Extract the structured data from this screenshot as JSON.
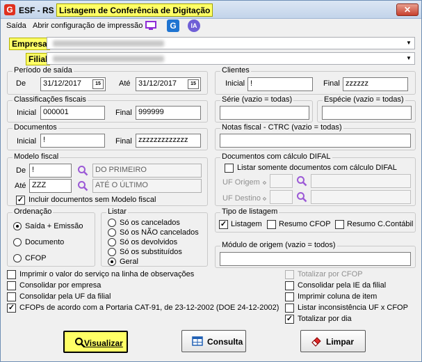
{
  "window": {
    "app_logo": "G",
    "title_prefix": "ESF - RS -",
    "title": "Listagem de Conferência de Digitação",
    "close_label": "✕"
  },
  "menu": {
    "saida": "Saída",
    "abrir_config": "Abrir configuração de impressão"
  },
  "toolbar_icons": [
    "monitor-icon",
    "g-logo-icon",
    "ia-icon"
  ],
  "toolbar": {
    "ia_label": "IA",
    "g_label": "G"
  },
  "empresa": {
    "label": "Empresa"
  },
  "filial": {
    "label": "Filial"
  },
  "periodo": {
    "title": "Período de saída",
    "de_label": "De",
    "de_value": "31/12/2017",
    "ate_label": "Até",
    "ate_value": "31/12/2017",
    "cal_label": "15"
  },
  "clientes": {
    "title": "Clientes",
    "inicial_label": "Inicial",
    "inicial_value": "!",
    "final_label": "Final",
    "final_value": "zzzzzz"
  },
  "classificacoes": {
    "title": "Classificações fiscais",
    "inicial_label": "Inicial",
    "inicial_value": "000001",
    "final_label": "Final",
    "final_value": "999999"
  },
  "serie": {
    "title": "Série (vazio = todas)",
    "value": ""
  },
  "especie": {
    "title": "Espécie (vazio = todas)",
    "value": ""
  },
  "documentos": {
    "title": "Documentos",
    "inicial_label": "Inicial",
    "inicial_value": "!",
    "final_label": "Final",
    "final_value": "zzzzzzzzzzzzz"
  },
  "notas_fiscal": {
    "title": "Notas fiscal - CTRC (vazio = todas)",
    "value": ""
  },
  "modelo_fiscal": {
    "title": "Modelo fiscal",
    "de_label": "De",
    "de_value": "!",
    "de_desc": "DO PRIMEIRO",
    "ate_label": "Até",
    "ate_value": "ZZZ",
    "ate_desc": "ATÉ O ÚLTIMO",
    "incluir_label": "Incluir documentos sem Modelo fiscal",
    "incluir_checked": true
  },
  "difal": {
    "title": "Documentos com cálculo DIFAL",
    "listar_label": "Listar somente documentos com cálculo DIFAL",
    "listar_checked": false,
    "uf_origem_label": "UF Origem",
    "uf_destino_label": "UF Destino"
  },
  "ordenacao": {
    "title": "Ordenação",
    "options": [
      "Saída + Emissão",
      "Documento",
      "CFOP"
    ],
    "selected": 0
  },
  "listar": {
    "title": "Listar",
    "options": [
      "Só os cancelados",
      "Só os NÃO cancelados",
      "Só os devolvidos",
      "Só os substituídos",
      "Geral"
    ],
    "selected": 4
  },
  "tipo_listagem": {
    "title": "Tipo de listagem",
    "listagem_label": "Listagem",
    "listagem_checked": true,
    "resumo_cfop_label": "Resumo  CFOP",
    "resumo_cfop_checked": false,
    "resumo_contabil_label": "Resumo C.Contábil",
    "resumo_contabil_checked": false
  },
  "modulo_origem": {
    "title": "Módulo de origem (vazio = todos)",
    "value": ""
  },
  "options_left": [
    {
      "label": "Imprimir o valor do serviço na linha de observações",
      "checked": false
    },
    {
      "label": "Consolidar por empresa",
      "checked": false
    },
    {
      "label": "Consolidar pela UF da filial",
      "checked": false
    },
    {
      "label": "CFOPs de acordo com a Portaria CAT-91, de 23-12-2002 (DOE 24-12-2002)",
      "checked": true
    }
  ],
  "options_right": [
    {
      "label": "Totalizar por CFOP",
      "checked": false,
      "disabled": true
    },
    {
      "label": "Consolidar pela IE da filial",
      "checked": false,
      "disabled": false
    },
    {
      "label": "Imprimir coluna de item",
      "checked": false,
      "disabled": false
    },
    {
      "label": "Listar inconsistência UF x CFOP",
      "checked": false,
      "disabled": false
    },
    {
      "label": "Totalizar por dia",
      "checked": true,
      "disabled": false
    }
  ],
  "buttons": {
    "visualizar": "Visualizar",
    "consulta": "Consulta",
    "limpar": "Limpar"
  },
  "colors": {
    "highlight": "#ffff66",
    "title_gradient_top": "#dbe6f4",
    "close_red": "#c7402e",
    "search_purple": "#9b59d6"
  }
}
